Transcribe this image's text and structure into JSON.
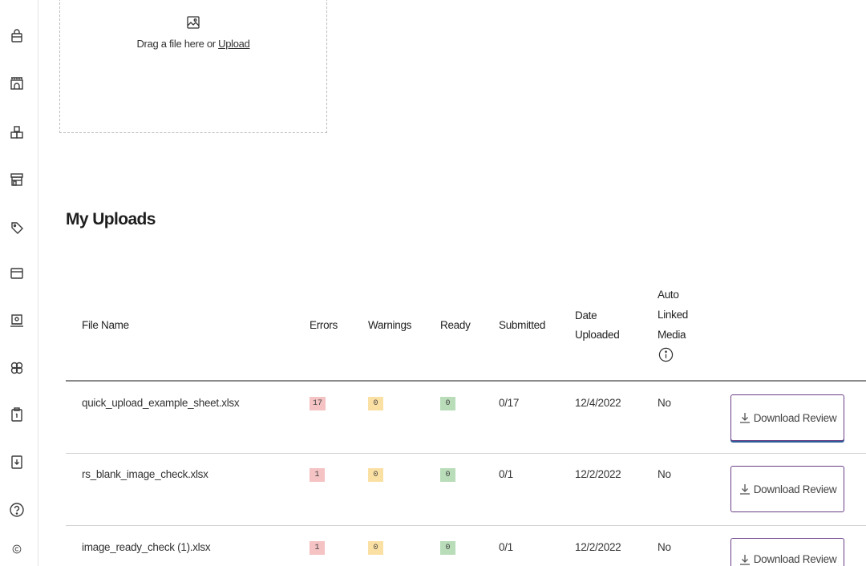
{
  "sidebar": {
    "icons": [
      "shopping-bag-icon",
      "storefront-icon",
      "boxes-icon",
      "shop-icon",
      "tag-icon",
      "card-icon",
      "catalog-icon",
      "network-icon",
      "clipboard-icon",
      "download-document-icon",
      "help-icon",
      "copyright-icon"
    ]
  },
  "dropzone": {
    "icon": "image-icon",
    "prompt": "Drag a file here or",
    "link": "Upload"
  },
  "uploads": {
    "title": "My Uploads",
    "columns": {
      "file_name": "File Name",
      "errors": "Errors",
      "warnings": "Warnings",
      "ready": "Ready",
      "submitted": "Submitted",
      "date_line1": "Date",
      "date_line2": "Uploaded",
      "auto_line1": "Auto",
      "auto_line2": "Linked",
      "auto_line3": "Media"
    },
    "rows": [
      {
        "file": "quick_upload_example_sheet.xlsx",
        "errors": "17",
        "warnings": "0",
        "ready": "0",
        "submitted": "0/17",
        "date": "12/4/2022",
        "auto_linked": "No",
        "action": "Download Review"
      },
      {
        "file": "rs_blank_image_check.xlsx",
        "errors": "1",
        "warnings": "0",
        "ready": "0",
        "submitted": "0/1",
        "date": "12/2/2022",
        "auto_linked": "No",
        "action": "Download Review"
      },
      {
        "file": "image_ready_check (1).xlsx",
        "errors": "1",
        "warnings": "0",
        "ready": "0",
        "submitted": "0/1",
        "date": "12/2/2022",
        "auto_linked": "No",
        "action": "Download Review"
      }
    ]
  },
  "colors": {
    "error_badge": "#f5c3c3",
    "warning_badge": "#fbe0a3",
    "ready_badge": "#b9dcb9",
    "button_border": "#6b3f86"
  }
}
